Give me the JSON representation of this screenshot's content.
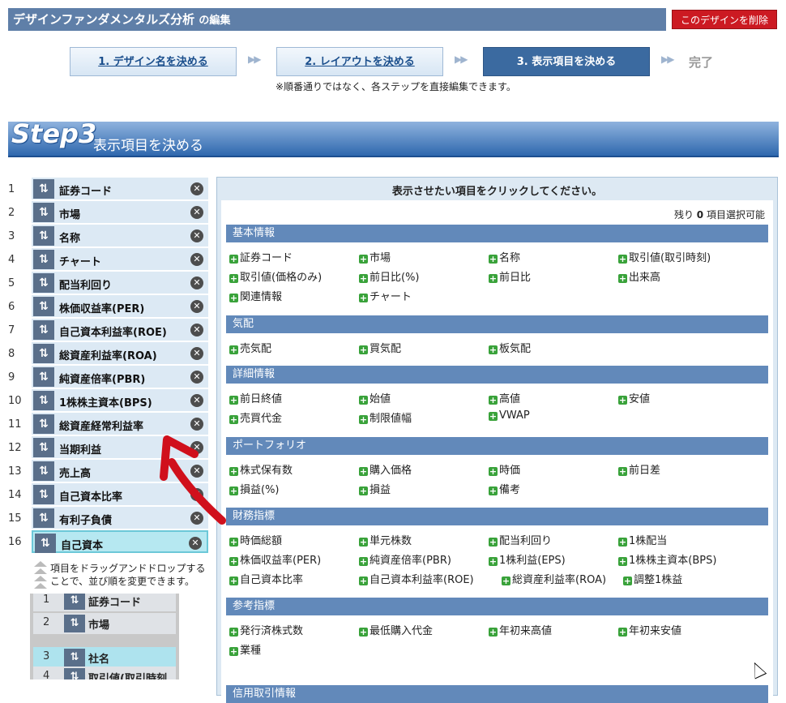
{
  "header": {
    "title": "デザインファンダメンタルズ分析",
    "title_suffix": "の編集",
    "delete_label": "このデザインを削除"
  },
  "steps": [
    {
      "label": "1. デザイン名を決める",
      "state": "link"
    },
    {
      "label": "2. レイアウトを決める",
      "state": "link"
    },
    {
      "label": "3. 表示項目を決める",
      "state": "active"
    }
  ],
  "steps_done_label": "完了",
  "steps_arrow": "▶▶",
  "steps_note": "※順番通りではなく、各ステップを直接編集できます。",
  "banner": {
    "step_label": "Step3",
    "title": "表示項目を決める"
  },
  "selected": {
    "items": [
      {
        "num": "1",
        "label": "証券コード"
      },
      {
        "num": "2",
        "label": "市場"
      },
      {
        "num": "3",
        "label": "名称"
      },
      {
        "num": "4",
        "label": "チャート"
      },
      {
        "num": "5",
        "label": "配当利回り"
      },
      {
        "num": "6",
        "label": "株価収益率(PER)"
      },
      {
        "num": "7",
        "label": "自己資本利益率(ROE)"
      },
      {
        "num": "8",
        "label": "総資産利益率(ROA)"
      },
      {
        "num": "9",
        "label": "純資産倍率(PBR)"
      },
      {
        "num": "10",
        "label": "1株株主資本(BPS)"
      },
      {
        "num": "11",
        "label": "総資産経常利益率"
      },
      {
        "num": "12",
        "label": "当期利益"
      },
      {
        "num": "13",
        "label": "売上高"
      },
      {
        "num": "14",
        "label": "自己資本比率"
      },
      {
        "num": "15",
        "label": "有利子負債"
      },
      {
        "num": "16",
        "label": "自己資本"
      }
    ],
    "drag_hint": "項目をドラッグアンドドロップすることで、並び順を変更できます。",
    "demo_rows": [
      {
        "num": "1",
        "label": "証券コード"
      },
      {
        "num": "2",
        "label": "市場"
      },
      {
        "num": "3",
        "label": "社名"
      },
      {
        "num": "4",
        "label": "取引値(取引時刻"
      }
    ]
  },
  "panel": {
    "title": "表示させたい項目をクリックしてください。",
    "remaining_prefix": "残り",
    "remaining_count": "0",
    "remaining_suffix": "項目選択可能",
    "sections": [
      {
        "name": "基本情報",
        "items": [
          "証券コード",
          "市場",
          "名称",
          "取引値(取引時刻)",
          "取引値(価格のみ)",
          "前日比(%)",
          "前日比",
          "出来高",
          "関連情報",
          "チャート"
        ]
      },
      {
        "name": "気配",
        "items": [
          "売気配",
          "買気配",
          "板気配"
        ]
      },
      {
        "name": "詳細情報",
        "items": [
          "前日終値",
          "始値",
          "高値",
          "安値",
          "売買代金",
          "制限値幅",
          "VWAP"
        ]
      },
      {
        "name": "ポートフォリオ",
        "items": [
          "株式保有数",
          "購入価格",
          "時価",
          "前日差",
          "損益(%)",
          "損益",
          "備考"
        ]
      },
      {
        "name": "財務指標",
        "items": [
          "時価総額",
          "単元株数",
          "配当利回り",
          "1株配当",
          "株価収益率(PER)",
          "純資産倍率(PBR)",
          "1株利益(EPS)",
          "1株株主資本(BPS)",
          "自己資本比率",
          "自己資本利益率(ROE)",
          "総資産利益率(ROA)",
          "調整1株益"
        ]
      },
      {
        "name": "参考指標",
        "items": [
          "発行済株式数",
          "最低購入代金",
          "年初来高値",
          "年初来安値",
          "業種"
        ]
      },
      {
        "name": "信用取引情報",
        "items": []
      }
    ]
  },
  "icons": {
    "handle": "⇅",
    "remove": "✕",
    "plus": "+"
  },
  "colors": {
    "accent": "#3b6aa0",
    "danger": "#cc1a22",
    "add": "#39a23a",
    "annotation": "#d0101c"
  }
}
